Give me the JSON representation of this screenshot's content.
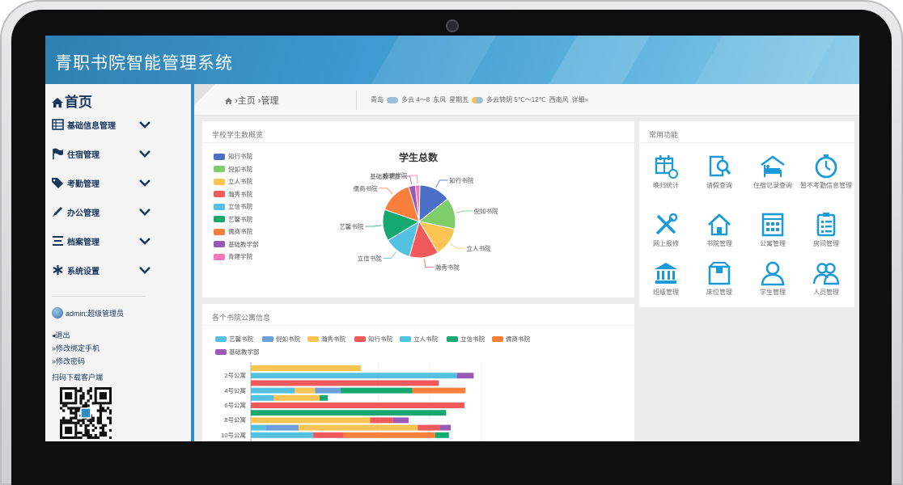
{
  "app": {
    "title": "青职书院智能管理系统"
  },
  "sidebar": {
    "home_label": "首页",
    "items": [
      {
        "label": "基础信息管理",
        "icon": "table-icon"
      },
      {
        "label": "住宿管理",
        "icon": "flag-icon"
      },
      {
        "label": "考勤管理",
        "icon": "tags-icon"
      },
      {
        "label": "办公管理",
        "icon": "pencil-icon"
      },
      {
        "label": "档案管理",
        "icon": "list-icon"
      },
      {
        "label": "系统设置",
        "icon": "asterisk-icon"
      }
    ],
    "user_label": "admin:超级管理员",
    "links": [
      "退出",
      "修改绑定手机",
      "修改密码"
    ],
    "qr_caption": "扫码下载客户端"
  },
  "breadcrumb": {
    "home": "主页",
    "separator": "›",
    "current": "管理"
  },
  "weather": {
    "city": "青岛",
    "today": "多云 4～8",
    "wind": "东风",
    "weekday": "星期五",
    "tomorrow": "多云转阴 5℃～12℃",
    "tomorrow_wind": "西南风",
    "detail": "详细»"
  },
  "pie_panel": {
    "title": "学校学生数概览"
  },
  "functions_panel": {
    "title": "常用功能",
    "items": [
      {
        "label": "晚归统计",
        "icon": "building-chart-icon"
      },
      {
        "label": "请假查询",
        "icon": "document-search-icon"
      },
      {
        "label": "住宿记录查询",
        "icon": "bed-house-icon"
      },
      {
        "label": "暂不考勤信息管理",
        "icon": "stopwatch-icon"
      },
      {
        "label": "网上报修",
        "icon": "tools-icon"
      },
      {
        "label": "书院管理",
        "icon": "house-icon"
      },
      {
        "label": "公寓管理",
        "icon": "apartment-icon"
      },
      {
        "label": "房间管理",
        "icon": "clipboard-icon"
      },
      {
        "label": "班级管理",
        "icon": "bank-icon"
      },
      {
        "label": "床位管理",
        "icon": "box-icon"
      },
      {
        "label": "学生管理",
        "icon": "student-icon"
      },
      {
        "label": "人员管理",
        "icon": "users-icon"
      }
    ]
  },
  "bar_panel": {
    "title": "各个书院公寓信息"
  },
  "chart_data": [
    {
      "type": "pie",
      "title": "学生总数",
      "slices": [
        {
          "name": "知行书院",
          "value": 14,
          "color": "#4b6fc9"
        },
        {
          "name": "倪如书院",
          "value": 14,
          "color": "#7fcc6a"
        },
        {
          "name": "立人书院",
          "value": 13,
          "color": "#f9c452"
        },
        {
          "name": "瀚秀书院",
          "value": 13,
          "color": "#f15a5a"
        },
        {
          "name": "立信书院",
          "value": 12,
          "color": "#55c1e0"
        },
        {
          "name": "艺馨书院",
          "value": 14,
          "color": "#16a871"
        },
        {
          "name": "儒商书院",
          "value": 15,
          "color": "#f97f3c"
        },
        {
          "name": "基础教学部",
          "value": 3,
          "color": "#9b59b6"
        },
        {
          "name": "青建学院",
          "value": 2,
          "color": "#f478b8"
        }
      ]
    },
    {
      "type": "bar",
      "orientation": "horizontal",
      "stacked": true,
      "categories": [
        "2号公寓",
        "4号公寓",
        "6号公寓",
        "8号公寓",
        "10号公寓"
      ],
      "series_legend": [
        {
          "name": "艺馨书院",
          "color": "#55c1e0"
        },
        {
          "name": "倪如书院",
          "color": "#6a9fd8"
        },
        {
          "name": "瀚秀书院",
          "color": "#f9c452"
        },
        {
          "name": "知行书院",
          "color": "#f15a5a"
        },
        {
          "name": "立人书院",
          "color": "#4ec3e0"
        },
        {
          "name": "立信书院",
          "color": "#16a871"
        },
        {
          "name": "儒商书院",
          "color": "#f97f3c"
        },
        {
          "name": "基础教学部",
          "color": "#9b59b6"
        }
      ],
      "rows": [
        [
          {
            "color": "#f9c452",
            "value": 120
          }
        ],
        [
          {
            "color": "#55c1e0",
            "value": 225
          },
          {
            "color": "#9b59b6",
            "value": 18
          }
        ],
        [
          {
            "color": "#f15a5a",
            "value": 205
          }
        ],
        [
          {
            "color": "#55c1e0",
            "value": 48
          },
          {
            "color": "#f9c452",
            "value": 22
          },
          {
            "color": "#6a9fd8",
            "value": 28
          },
          {
            "color": "#16a871",
            "value": 78
          },
          {
            "color": "#f97f3c",
            "value": 58
          }
        ],
        [
          {
            "color": "#55c1e0",
            "value": 25
          },
          {
            "color": "#f9c452",
            "value": 50
          },
          {
            "color": "#16a871",
            "value": 9
          }
        ],
        [
          {
            "color": "#f15a5a",
            "value": 233
          }
        ],
        [
          {
            "color": "#16a871",
            "value": 213
          }
        ],
        [
          {
            "color": "#f9c452",
            "value": 130
          },
          {
            "color": "#f15a5a",
            "value": 25
          },
          {
            "color": "#9b59b6",
            "value": 17
          }
        ],
        [
          {
            "color": "#55c1e0",
            "value": 16
          },
          {
            "color": "#6a9fd8",
            "value": 36
          },
          {
            "color": "#f9c452",
            "value": 130
          },
          {
            "color": "#f15a5a",
            "value": 24
          },
          {
            "color": "#9b59b6",
            "value": 12
          }
        ],
        [
          {
            "color": "#55c1e0",
            "value": 68
          },
          {
            "color": "#f15a5a",
            "value": 33
          },
          {
            "color": "#f97f3c",
            "value": 100
          },
          {
            "color": "#16a871",
            "value": 15
          }
        ]
      ],
      "xlim": [
        0,
        300
      ]
    }
  ]
}
